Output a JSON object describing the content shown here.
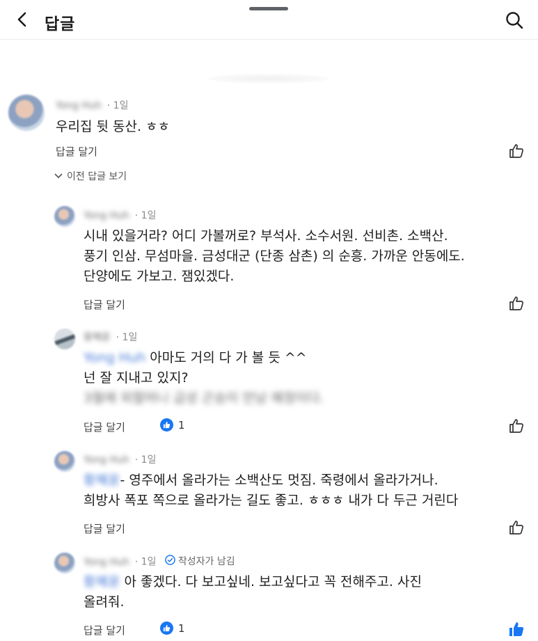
{
  "header": {
    "title": "답글"
  },
  "thread": {
    "previous_replies_label": "이전 답글 보기",
    "comments": [
      {
        "author": "Yong Huh",
        "time": "1일",
        "lines": [
          "우리집 뒷 동산.  ㅎㅎ"
        ],
        "reply_label": "답글 달기"
      },
      {
        "author": "Yong Huh",
        "time": "1일",
        "lines": [
          "시내 있을거라? 어디 가볼꺼로? 부석사. 소수서원.  선비촌. 소백산.",
          "풍기 인삼. 무섬마을. 금성대군 (단종 삼촌) 의 순흥. 가까운 안동에도.",
          "단양에도 가보고. 잼있겠다."
        ],
        "reply_label": "답글 달기"
      },
      {
        "author": "황혜윤",
        "time": "1일",
        "mention": "Yong Huh",
        "line1": "아마도 거의 다 가 볼 듯 ^^",
        "line2": "넌 잘 지내고 있지?",
        "blurred_line": "3월에 외할머니 급성 곤승이 만남 예정이다.",
        "reply_label": "답글 달기",
        "reaction_count": "1"
      },
      {
        "author": "Yong Huh",
        "time": "1일",
        "mention": "황혜윤",
        "line1": "- 영주에서 올라가는 소백산도 멋짐. 죽령에서 올라가거나.",
        "line2": "희방사 폭포 쪽으로 올라가는 길도 좋고. ㅎㅎㅎ 내가 다 두근 거린다",
        "reply_label": "답글 달기"
      },
      {
        "author": "Yong Huh",
        "time": "1일",
        "badge": "작성자가 남김",
        "mention": "황혜윤",
        "line1": " 아 좋겠다.  다 보고싶네. 보고싶다고 꼭 전해주고. 사진",
        "line2": "올려줘.",
        "reply_label": "답글 달기",
        "reaction_count": "1"
      }
    ]
  },
  "colors": {
    "accent": "#1877f2",
    "text": "#202020",
    "muted": "#8a8a8a"
  },
  "icons": [
    "back-arrow-icon",
    "search-icon",
    "chevron-down-icon",
    "thumbs-up-icon",
    "like-reaction-icon",
    "author-badge-icon"
  ]
}
